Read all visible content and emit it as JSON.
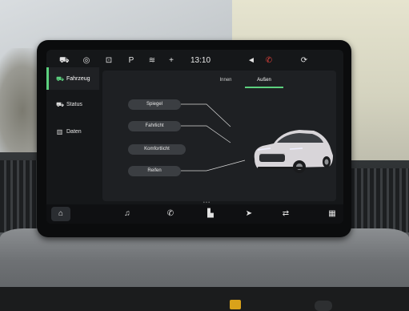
{
  "status_bar": {
    "time": "13:10",
    "icons": [
      "car-icon",
      "circle-badge-icon",
      "camera-icon",
      "parking-icon",
      "climate-icon",
      "plus-icon",
      "speaker-icon",
      "phone-muted-icon",
      "sync-icon"
    ]
  },
  "sidebar": {
    "items": [
      {
        "label": "Fahrzeug",
        "icon": "car-icon",
        "active": true
      },
      {
        "label": "Status",
        "icon": "status-icon",
        "active": false
      },
      {
        "label": "Daten",
        "icon": "data-icon",
        "active": false
      }
    ]
  },
  "tabs": [
    {
      "label": "Innen",
      "active": false
    },
    {
      "label": "Außen",
      "active": true
    }
  ],
  "options": [
    {
      "label": "Spiegel"
    },
    {
      "label": "Fahrlicht"
    },
    {
      "label": "Komfortlicht"
    },
    {
      "label": "Reifen"
    }
  ],
  "dock": {
    "items": [
      "home-icon",
      "music-icon",
      "phone-icon",
      "apps-icon",
      "navigation-icon",
      "connectivity-icon",
      "menu-grid-icon"
    ]
  },
  "colors": {
    "accent": "#5cd07e",
    "alert": "#e0413b"
  }
}
